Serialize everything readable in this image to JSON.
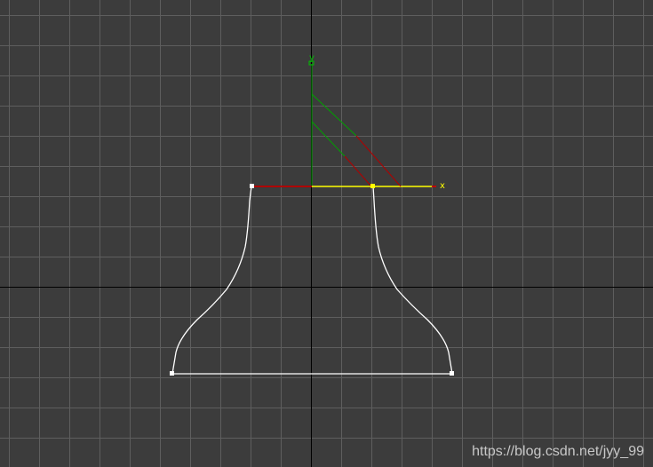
{
  "viewport": {
    "background": "#3c3c3c",
    "grid_color": "#5e5e5e",
    "world_axis_color": "#000000",
    "curve_color": "#ffffff",
    "selected_color": "#ffff00",
    "x_axis_color": "#c00000",
    "y_axis_color": "#00a000"
  },
  "gizmo": {
    "x_label": "x",
    "y_label": "y"
  },
  "watermark": {
    "text": "https://blog.csdn.net/jyy_99"
  }
}
